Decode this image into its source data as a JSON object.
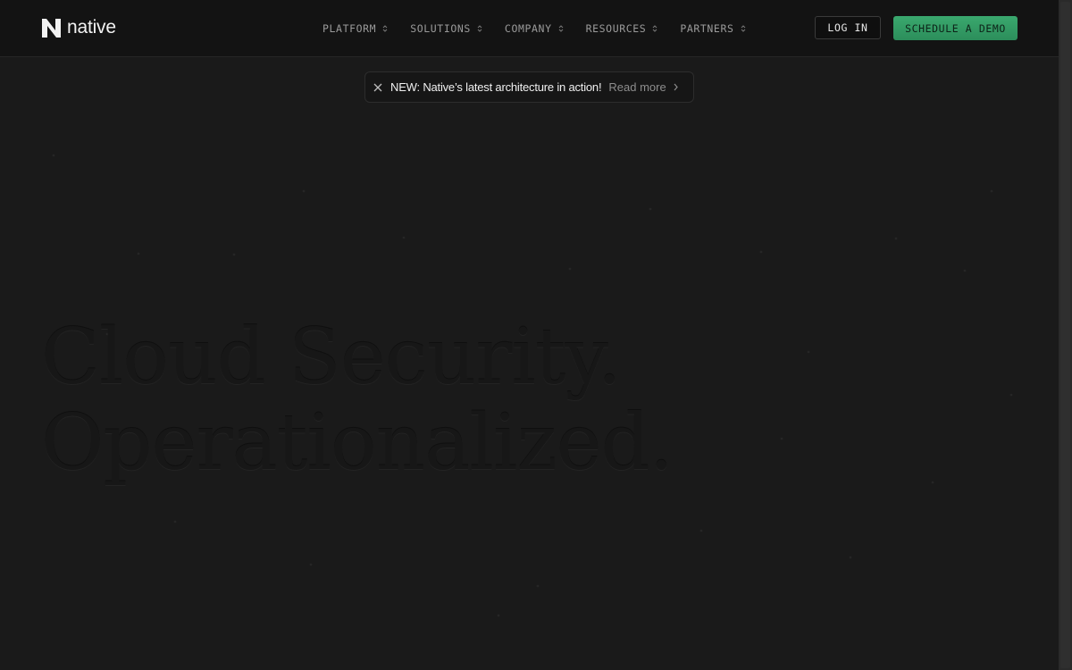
{
  "brand": {
    "name": "native",
    "accent": "#34a068"
  },
  "nav": {
    "items": [
      {
        "label": "PLATFORM"
      },
      {
        "label": "SOLUTIONS"
      },
      {
        "label": "COMPANY"
      },
      {
        "label": "RESOURCES"
      },
      {
        "label": "PARTNERS"
      }
    ]
  },
  "actions": {
    "login_label": "LOG IN",
    "demo_label": "SCHEDULE A DEMO"
  },
  "announcement": {
    "text": "NEW: Native’s latest architecture in action!",
    "link_label": "Read more"
  },
  "hero": {
    "line1": "Cloud Security.",
    "line2": "Operationalized."
  }
}
